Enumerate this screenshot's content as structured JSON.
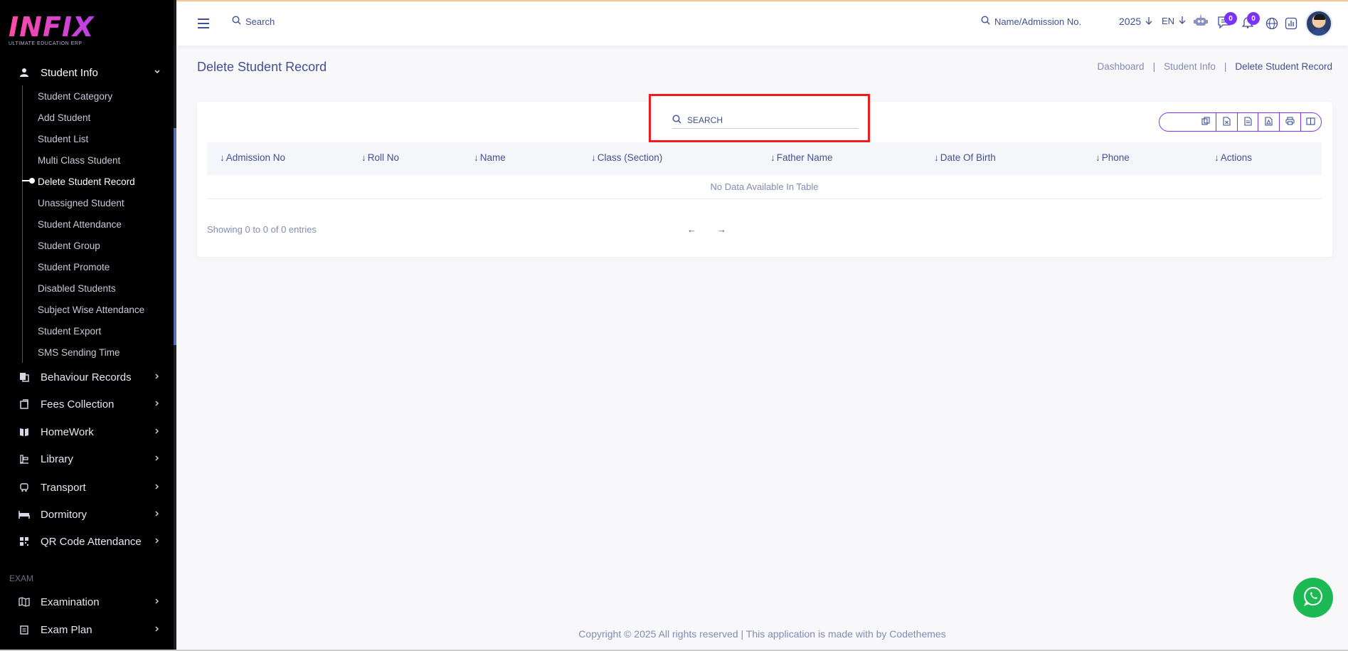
{
  "logo": {
    "text": "INFIX",
    "subtitle": "ULTIMATE EDUCATION ERP"
  },
  "sidebar": {
    "student_info": {
      "label": "Student Info",
      "icon": "user-icon"
    },
    "sub_items": [
      {
        "label": "Student Category"
      },
      {
        "label": "Add Student"
      },
      {
        "label": "Student List"
      },
      {
        "label": "Multi Class Student"
      },
      {
        "label": "Delete Student Record"
      },
      {
        "label": "Unassigned Student"
      },
      {
        "label": "Student Attendance"
      },
      {
        "label": "Student Group"
      },
      {
        "label": "Student Promote"
      },
      {
        "label": "Disabled Students"
      },
      {
        "label": "Subject Wise Attendance"
      },
      {
        "label": "Student Export"
      },
      {
        "label": "SMS Sending Time"
      }
    ],
    "menus": [
      {
        "label": "Behaviour Records",
        "icon": "copy-icon"
      },
      {
        "label": "Fees Collection",
        "icon": "receipt-icon"
      },
      {
        "label": "HomeWork",
        "icon": "book-icon"
      },
      {
        "label": "Library",
        "icon": "library-icon"
      },
      {
        "label": "Transport",
        "icon": "bus-icon"
      },
      {
        "label": "Dormitory",
        "icon": "bed-icon"
      },
      {
        "label": "QR Code Attendance",
        "icon": "qr-icon"
      }
    ],
    "section_exam": "EXAM",
    "exam_menus": [
      {
        "label": "Examination",
        "icon": "map-icon"
      },
      {
        "label": "Exam Plan",
        "icon": "clipboard-icon"
      }
    ]
  },
  "topbar": {
    "search_label": "Search",
    "name_search": "Name/Admission No.",
    "year": "2025",
    "lang": "EN",
    "chat_badge": "0",
    "notif_badge": "0"
  },
  "page": {
    "title": "Delete Student Record",
    "breadcrumb": [
      "Dashboard",
      "Student Info",
      "Delete Student Record"
    ],
    "breadcrumb_sep": "|"
  },
  "table": {
    "search_placeholder": "SEARCH",
    "columns": [
      "Admission No",
      "Roll No",
      "Name",
      "Class (Section)",
      "Father Name",
      "Date Of Birth",
      "Phone",
      "Actions"
    ],
    "empty_text": "No Data Available In Table",
    "showing": "Showing 0 to 0 of 0 entries",
    "prev": "←",
    "next": "→"
  },
  "footer": {
    "text": "Copyright © 2025 All rights reserved | This application is made with by Codethemes"
  },
  "colors": {
    "accent": "#7c32ff",
    "primary_text": "#415094",
    "highlight_border": "#ee1c1c",
    "whatsapp": "#1db954"
  }
}
